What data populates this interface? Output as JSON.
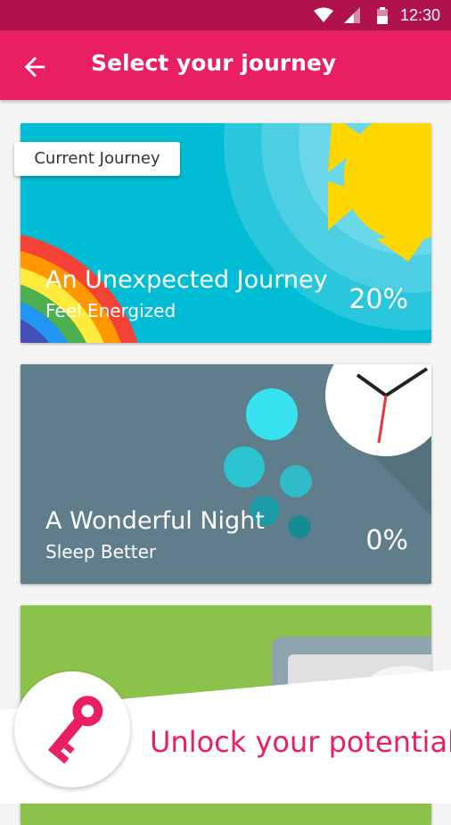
{
  "status_bar": {
    "time": "12:30"
  },
  "app_bar": {
    "title": "Select your journey"
  },
  "chip": {
    "label": "Current Journey"
  },
  "journeys": [
    {
      "title": "An Unexpected Journey",
      "subtitle": "Feel Energized",
      "percent": "20%",
      "color": "#00bcd4"
    },
    {
      "title": "A Wonderful Night",
      "subtitle": "Sleep Better",
      "percent": "0%",
      "color": "#607d8b"
    },
    {
      "title": "",
      "subtitle": "",
      "percent": "",
      "color": "#8bc34a"
    }
  ],
  "promo": {
    "text": "Unlock your potential",
    "accent": "#e91e63"
  },
  "colors": {
    "status_bar": "#b0134b",
    "app_bar": "#e91e63",
    "background": "#f4f4f4"
  }
}
